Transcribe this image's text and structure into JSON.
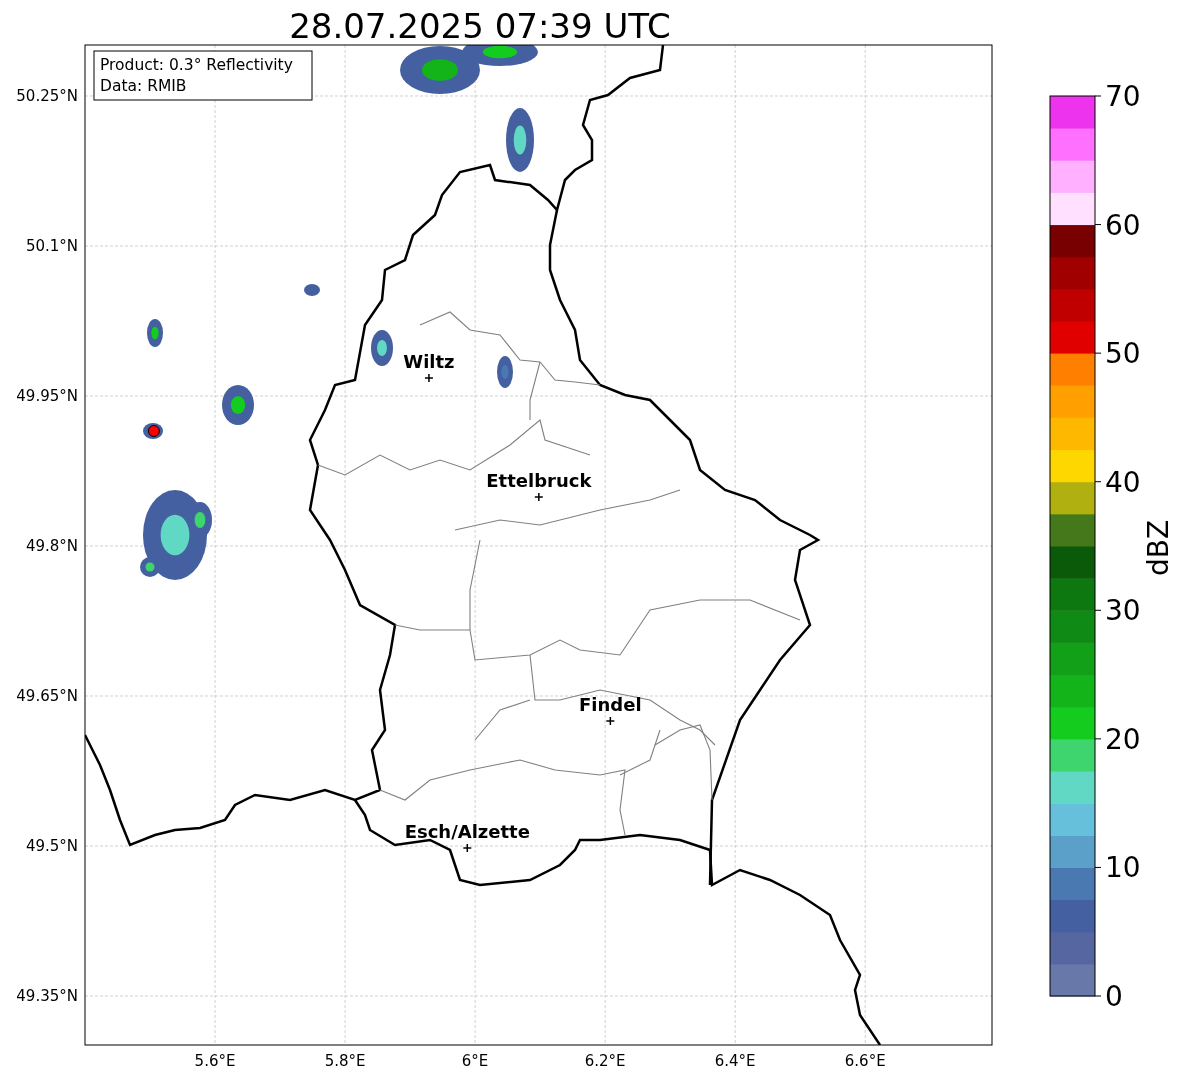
{
  "title": "28.07.2025 07:39 UTC",
  "map": {
    "legend": [
      "Product: 0.3° Reflectivity",
      "Data: RMIB"
    ],
    "lat_ticks": [
      "50.25°N",
      "50.1°N",
      "49.95°N",
      "49.8°N",
      "49.65°N",
      "49.5°N",
      "49.35°N"
    ],
    "lon_ticks": [
      "5.6°E",
      "5.8°E",
      "6°E",
      "6.2°E",
      "6.4°E",
      "6.6°E"
    ],
    "cities": [
      {
        "name": "Wiltz"
      },
      {
        "name": "Ettelbruck"
      },
      {
        "name": "Findel"
      },
      {
        "name": "Esch/Alzette"
      }
    ],
    "radar_site": {
      "color": "#ff0000"
    }
  },
  "colorbar": {
    "label": "dBZ",
    "ticks": [
      "70",
      "60",
      "50",
      "40",
      "30",
      "20",
      "10",
      "0"
    ]
  }
}
